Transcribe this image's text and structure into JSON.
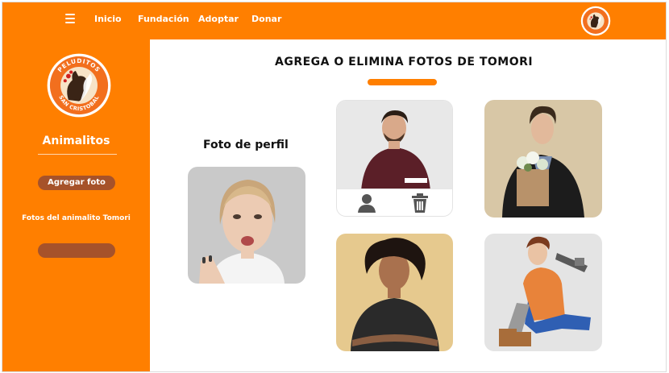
{
  "nav": {
    "menu_icon": "hamburger-menu-icon",
    "links": [
      "Inicio",
      "Fundación",
      "Adoptar",
      "Donar"
    ]
  },
  "logo": {
    "text_top": "PELUDITOS",
    "text_bottom": "SAN CRISTOBAL"
  },
  "sidebar": {
    "title": "Animalitos",
    "add_photo_label": "Agregar foto",
    "photos_link": "Fotos del animalito Tomori",
    "empty_button_label": ""
  },
  "main": {
    "title": "AGREGA O ELIMINA FOTOS DE TOMORI",
    "profile_label": "Foto de perfil",
    "photo_actions": {
      "set_profile_icon": "user-icon",
      "delete_icon": "trash-icon"
    }
  },
  "colors": {
    "brand_orange": "#ff7f00",
    "button_brown": "#a6522a",
    "icon_gray": "#555555"
  }
}
